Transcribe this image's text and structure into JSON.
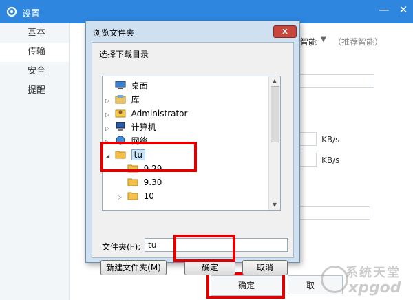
{
  "window": {
    "title": "设置",
    "minimize": "—",
    "close": "✕"
  },
  "sidebar": {
    "items": [
      {
        "label": "基本"
      },
      {
        "label": "传输"
      },
      {
        "label": "安全"
      },
      {
        "label": "提醒"
      }
    ]
  },
  "settings": {
    "mode_value": "智能",
    "mode_hint": "（推荐智能）",
    "unit1": "KB/s",
    "unit2": "KB/s"
  },
  "footer": {
    "ok_label": "确定",
    "cancel_label": "取"
  },
  "watermark": {
    "top": "系统天堂",
    "bottom": "xpgod"
  },
  "dialog": {
    "title": "浏览文件夹",
    "prompt": "选择下载目录",
    "tree": [
      {
        "label": "桌面"
      },
      {
        "label": "库"
      },
      {
        "label": "Administrator"
      },
      {
        "label": "计算机"
      },
      {
        "label": "网络"
      },
      {
        "label": "tu"
      },
      {
        "label": "9.29"
      },
      {
        "label": "9.30"
      },
      {
        "label": "10"
      }
    ],
    "folder_label": "文件夹(F):",
    "folder_value": "tu",
    "new_folder_label": "新建文件夹(M)",
    "ok_label": "确定",
    "cancel_label": "取消",
    "close_glyph": "x"
  },
  "colors": {
    "titlebar": "#2e86de",
    "highlight": "#e00000"
  }
}
